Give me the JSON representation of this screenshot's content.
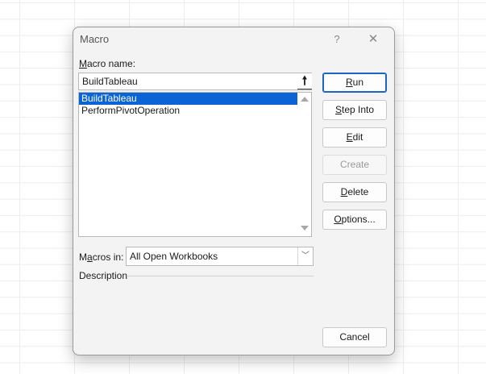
{
  "dialog": {
    "title": "Macro",
    "help_glyph": "?",
    "close_glyph": "✕"
  },
  "macro_name": {
    "label_mnemonic": "M",
    "label_rest": "acro name:",
    "value": "BuildTableau",
    "up_glyph": "🠕"
  },
  "macro_list": {
    "items": [
      {
        "label": "BuildTableau",
        "selected": true
      },
      {
        "label": "PerformPivotOperation",
        "selected": false
      }
    ]
  },
  "buttons": {
    "run": {
      "mnemonic": "R",
      "rest": "un"
    },
    "step_into": {
      "mnemonic": "S",
      "rest": "tep Into"
    },
    "edit": {
      "mnemonic": "E",
      "rest": "dit"
    },
    "create": {
      "label": "Create"
    },
    "delete": {
      "mnemonic": "D",
      "rest": "elete"
    },
    "options": {
      "mnemonic": "O",
      "rest": "ptions..."
    },
    "cancel": {
      "label": "Cancel"
    }
  },
  "macros_in": {
    "label_pre": "M",
    "label_mnemonic": "a",
    "label_rest": "cros in:",
    "value": "All Open Workbooks",
    "arrow_glyph": "﹀"
  },
  "description": {
    "label": "Description"
  },
  "colors": {
    "selection": "#0a64d6",
    "default_button_border": "#1b64c8"
  }
}
